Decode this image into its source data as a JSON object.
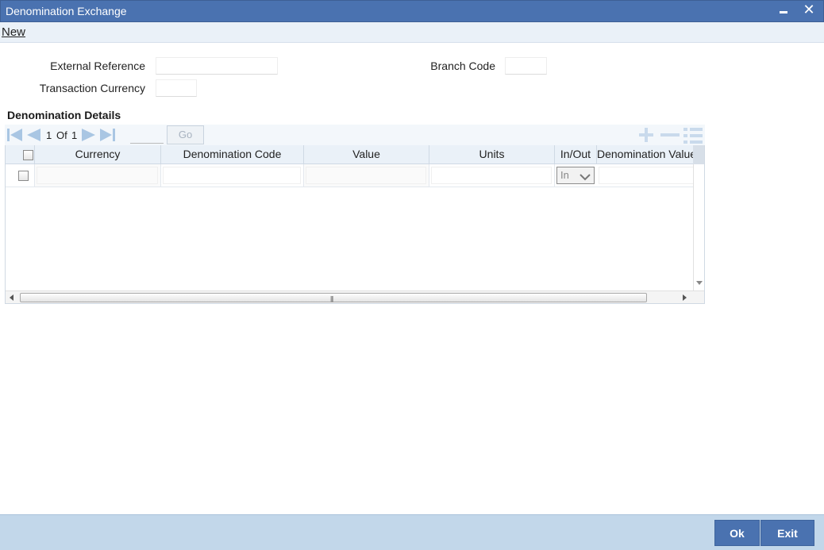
{
  "window": {
    "title": "Denomination Exchange",
    "minimize_icon": "minimize-icon",
    "close_icon": "close-icon",
    "close_glyph": "✕"
  },
  "menu": {
    "new_label": "New"
  },
  "form": {
    "external_reference_label": "External Reference",
    "external_reference_value": "",
    "transaction_currency_label": "Transaction Currency",
    "transaction_currency_value": "",
    "branch_code_label": "Branch Code",
    "branch_code_value": ""
  },
  "denomination": {
    "section_title": "Denomination Details",
    "pagination": {
      "current": "1",
      "of_label": "Of",
      "total": "1",
      "go_label": "Go"
    },
    "columns": [
      "Currency",
      "Denomination Code",
      "Value",
      "Units",
      "In/Out",
      "Denomination Value"
    ],
    "rows": [
      {
        "currency": "",
        "denomination_code": "",
        "value": "",
        "units": "",
        "in_out": "In",
        "denomination_value": ""
      }
    ]
  },
  "footer": {
    "ok_label": "Ok",
    "exit_label": "Exit"
  },
  "colors": {
    "titlebar": "#4a72b0",
    "footer": "#c2d7ea",
    "nav_icon": "#a9c6e3"
  }
}
